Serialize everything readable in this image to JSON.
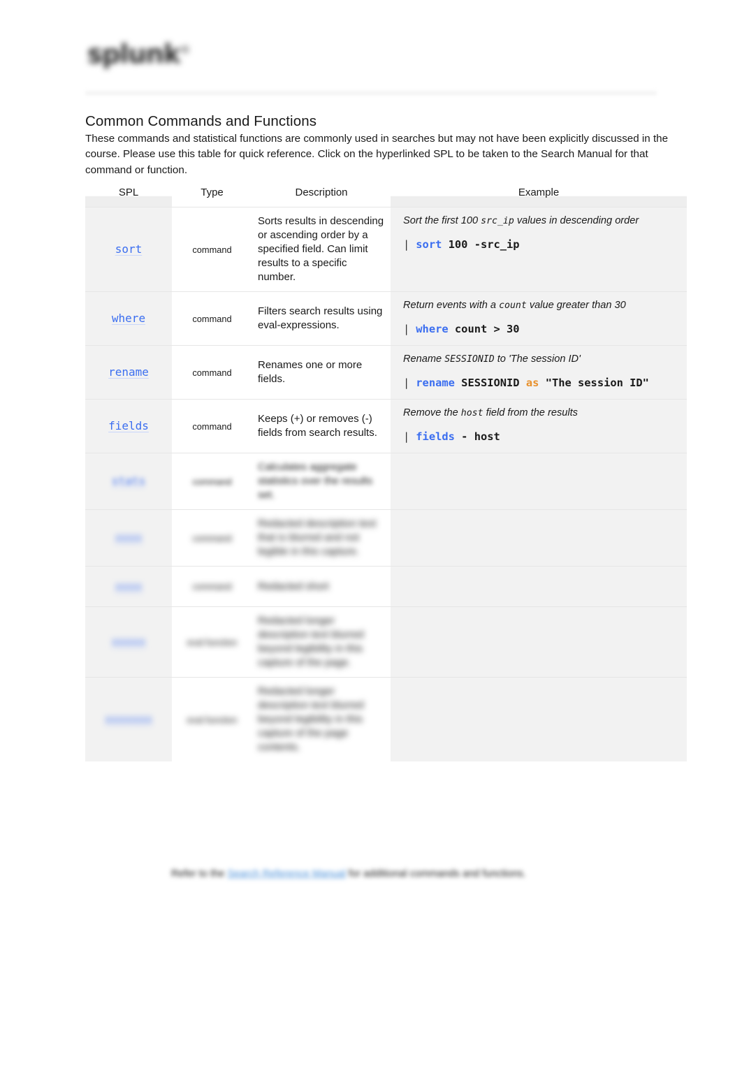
{
  "header": {
    "logo_text": "splunk",
    "logo_mark": "®"
  },
  "document": {
    "title": "Common Commands and Functions",
    "intro": "These commands and statistical functions are commonly used in searches but may not have been explicitly discussed in the course. Please use this table for quick reference. Click on the hyperlinked SPL to be taken to the Search Manual for that command or function."
  },
  "table": {
    "columns": [
      "SPL",
      "Type",
      "Description",
      "Example"
    ],
    "rows": [
      {
        "spl": "sort",
        "type": "command",
        "description": "Sorts results in descending or ascending order by a specified field. Can limit results to a specific number.",
        "example_caption_pre": "Sort the first 100 ",
        "example_caption_mono": "src_ip",
        "example_caption_post": " values in descending order",
        "example_pipe": "|",
        "example_cmd": "sort",
        "example_args": "100 -src_ip",
        "example_keyword": "",
        "example_tail": "",
        "blurred": false
      },
      {
        "spl": "where",
        "type": "command",
        "description": "Filters search results using eval-expressions.",
        "example_caption_pre": "Return events with a ",
        "example_caption_mono": "count",
        "example_caption_post": " value greater than 30",
        "example_pipe": "|",
        "example_cmd": "where",
        "example_args": "count > 30",
        "example_keyword": "",
        "example_tail": "",
        "blurred": false
      },
      {
        "spl": "rename",
        "type": "command",
        "description": "Renames one or more fields.",
        "example_caption_pre": "Rename ",
        "example_caption_mono": "SESSIONID",
        "example_caption_post": " to 'The session ID'",
        "example_pipe": "|",
        "example_cmd": "rename",
        "example_args": "SESSIONID",
        "example_keyword": "as",
        "example_tail": "\"The session ID\"",
        "blurred": false
      },
      {
        "spl": "fields",
        "type": "command",
        "description": "Keeps (+) or removes (-) fields from search results.",
        "example_caption_pre": "Remove the ",
        "example_caption_mono": "host",
        "example_caption_post": " field from the results",
        "example_pipe": "|",
        "example_cmd": "fields",
        "example_args": "- host",
        "example_keyword": "",
        "example_tail": "",
        "blurred": false
      },
      {
        "spl": "stats",
        "type": "command",
        "description": "Calculates aggregate statistics over the results set.",
        "example_caption_pre": "",
        "example_caption_mono": "",
        "example_caption_post": "",
        "example_pipe": "",
        "example_cmd": "",
        "example_args": "",
        "example_keyword": "",
        "example_tail": "",
        "blurred": true,
        "blur_level": "blur-2",
        "example_blurred": true
      },
      {
        "spl": "xxxx",
        "type": "command",
        "description": "Redacted description text that is blurred and not legible in this capture.",
        "example_caption_pre": "",
        "example_caption_mono": "",
        "example_caption_post": "",
        "example_pipe": "",
        "example_cmd": "",
        "example_args": "",
        "example_keyword": "",
        "example_tail": "",
        "blurred": true,
        "blur_level": "blur-3",
        "example_blurred": true
      },
      {
        "spl": "xxxx",
        "type": "command",
        "description": "Redacted short",
        "example_caption_pre": "",
        "example_caption_mono": "",
        "example_caption_post": "",
        "example_pipe": "",
        "example_cmd": "",
        "example_args": "",
        "example_keyword": "",
        "example_tail": "",
        "blurred": true,
        "blur_level": "blur-3",
        "example_blurred": true
      },
      {
        "spl": "xxxxx",
        "type": "eval function",
        "description": "Redacted longer description text blurred beyond legibility in this capture of the page.",
        "example_caption_pre": "",
        "example_caption_mono": "",
        "example_caption_post": "",
        "example_pipe": "",
        "example_cmd": "",
        "example_args": "",
        "example_keyword": "",
        "example_tail": "",
        "blurred": true,
        "blur_level": "blur-3",
        "example_blurred": true
      },
      {
        "spl": "xxxxxxx",
        "type": "eval function",
        "description": "Redacted longer description text blurred beyond legibility in this capture of the page contents.",
        "example_caption_pre": "",
        "example_caption_mono": "",
        "example_caption_post": "",
        "example_pipe": "",
        "example_cmd": "",
        "example_args": "",
        "example_keyword": "",
        "example_tail": "",
        "blurred": true,
        "blur_level": "blur-3",
        "example_blurred": true
      }
    ]
  },
  "footer": {
    "text_before": "Refer to the ",
    "link_text": "Search Reference Manual",
    "text_after": " for additional commands and functions."
  },
  "colors": {
    "link_blue": "#3b6ef0",
    "keyword_orange": "#e8912d",
    "cell_gray": "#f2f2f2",
    "text": "#1a1a1a"
  }
}
